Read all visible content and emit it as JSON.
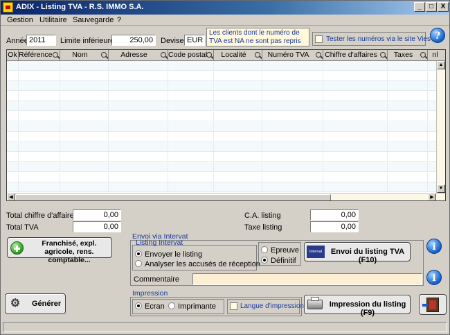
{
  "window": {
    "title": "ADIX - Listing TVA - R.S. IMMO S.A.",
    "minimize": "_",
    "maximize": "□",
    "close": "X"
  },
  "menu": [
    "Gestion",
    "Utilitaire",
    "Sauvegarde",
    "?"
  ],
  "filters": {
    "annee_label": "Année",
    "annee_value": "2011",
    "limite_label": "Limite inférieure",
    "limite_value": "250,00",
    "devise_label": "Devise",
    "devise_value": "EUR",
    "notice": "Les clients dont le numéro de TVA est NA ne sont pas repris",
    "vies_label": "Tester les numéros via le site Vies",
    "help": "?"
  },
  "grid": {
    "columns": [
      "Ok",
      "Référence",
      "Nom",
      "Adresse",
      "Code postal",
      "Localité",
      "Numéro TVA",
      "Chiffre d'affaires",
      "Taxes",
      "nl"
    ],
    "row_count": 13
  },
  "totals": {
    "ca_label": "Total chiffre d'affaires",
    "ca_value": "0,00",
    "tva_label": "Total TVA",
    "tva_value": "0,00",
    "ca_listing_label": "C.A. listing",
    "ca_listing_value": "0,00",
    "taxe_listing_label": "Taxe listing",
    "taxe_listing_value": "0,00"
  },
  "franchise_button": "Franchisé, expl. agricole, rens. comptable...",
  "envoi": {
    "title": "Envoi via Intervat",
    "listing_title": "Listing Intervat",
    "envoyer": "Envoyer le listing",
    "analyser": "Analyser les accusés de réception",
    "epreuve": "Epreuve",
    "definitif": "Définitif",
    "intervat_logo": "Intervat",
    "send_button": "Envoi du listing TVA (F10)",
    "commentaire_label": "Commentaire",
    "commentaire_value": ""
  },
  "impression": {
    "title": "Impression",
    "ecran": "Ecran",
    "imprimante": "Imprimante",
    "langue": "Langue d'impression",
    "print_button": "Impression du listing (F9)"
  },
  "generer_button": "Générer",
  "info": "i"
}
